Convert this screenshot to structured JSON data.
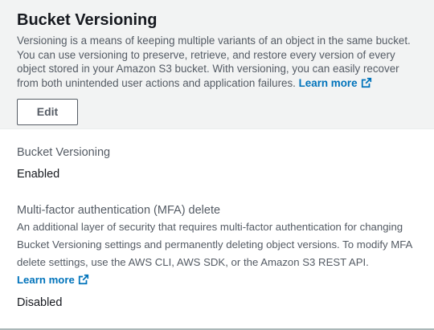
{
  "header": {
    "title": "Bucket Versioning",
    "description": "Versioning is a means of keeping multiple variants of an object in the same bucket. You can use versioning to preserve, retrieve, and restore every version of every object stored in your Amazon S3 bucket. With versioning, you can easily recover from both unintended user actions and application failures.",
    "learn_more_label": "Learn more",
    "edit_label": "Edit"
  },
  "fields": {
    "versioning": {
      "label": "Bucket Versioning",
      "value": "Enabled"
    },
    "mfa_delete": {
      "label": "Multi-factor authentication (MFA) delete",
      "description": "An additional layer of security that requires multi-factor authentication for changing Bucket Versioning settings and permanently deleting object versions. To modify MFA delete settings, use the AWS CLI, AWS SDK, or the Amazon S3 REST API.",
      "learn_more_label": "Learn more",
      "value": "Disabled"
    }
  },
  "icons": {
    "external_link": "external-link-icon"
  },
  "colors": {
    "link": "#0073bb",
    "header_bg": "#f2f3f3",
    "text_primary": "#16191f",
    "text_secondary": "#545b64"
  }
}
